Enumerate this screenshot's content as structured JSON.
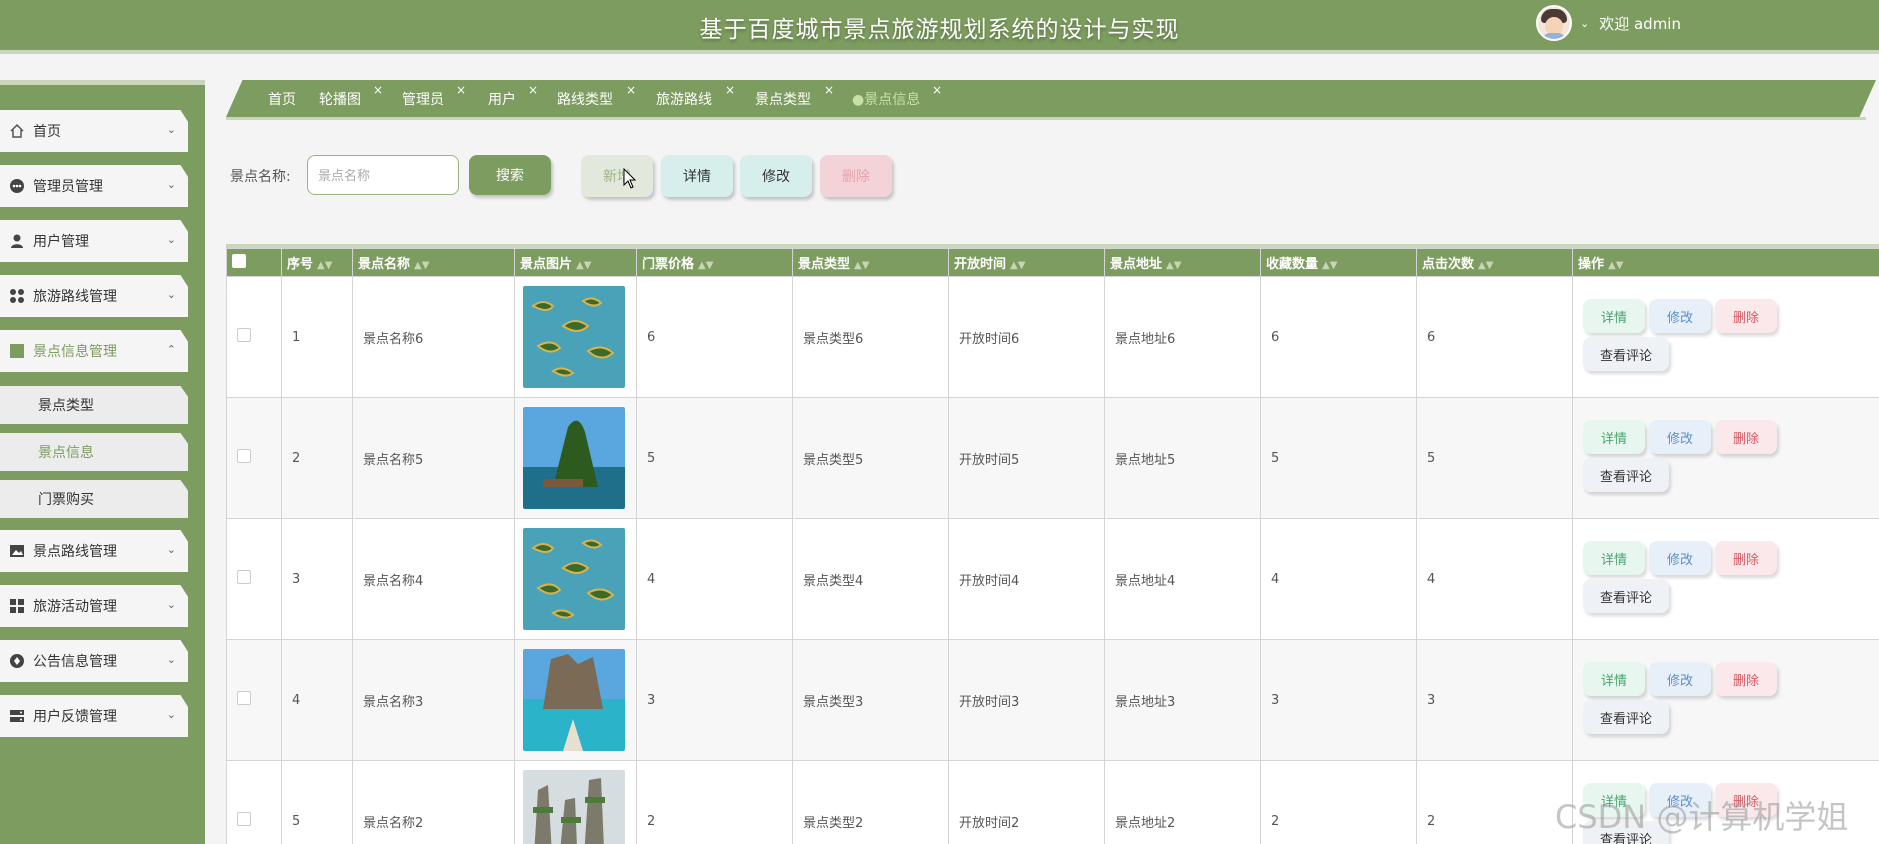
{
  "header": {
    "title": "基于百度城市景点旅游规划系统的设计与实现",
    "welcome": "欢迎 admin"
  },
  "sidebar": {
    "items": [
      {
        "label": "首页",
        "icon": "home-icon"
      },
      {
        "label": "管理员管理",
        "icon": "admin-icon"
      },
      {
        "label": "用户管理",
        "icon": "user-icon"
      },
      {
        "label": "旅游路线管理",
        "icon": "grid-icon"
      },
      {
        "label": "景点信息管理",
        "icon": "square-icon"
      },
      {
        "label": "景点路线管理",
        "icon": "image-icon"
      },
      {
        "label": "旅游活动管理",
        "icon": "tiles-icon"
      },
      {
        "label": "公告信息管理",
        "icon": "circle-icon"
      },
      {
        "label": "用户反馈管理",
        "icon": "server-icon"
      }
    ],
    "subitems": [
      {
        "label": "景点类型"
      },
      {
        "label": "景点信息"
      },
      {
        "label": "门票购买"
      }
    ]
  },
  "tabs": [
    {
      "label": "首页"
    },
    {
      "label": "轮播图"
    },
    {
      "label": "管理员"
    },
    {
      "label": "用户"
    },
    {
      "label": "路线类型"
    },
    {
      "label": "旅游路线"
    },
    {
      "label": "景点类型"
    },
    {
      "label": "●景点信息"
    }
  ],
  "tab_close": "×",
  "search": {
    "label": "景点名称:",
    "placeholder": "景点名称",
    "button": "搜索"
  },
  "toolbar": {
    "add": "新增",
    "detail": "详情",
    "edit": "修改",
    "delete": "删除"
  },
  "table": {
    "columns": [
      "序号",
      "景点名称",
      "景点图片",
      "门票价格",
      "景点类型",
      "开放时间",
      "景点地址",
      "收藏数量",
      "点击次数",
      "操作"
    ],
    "rows": [
      {
        "index": "1",
        "name": "景点名称6",
        "price": "6",
        "type": "景点类型6",
        "open": "开放时间6",
        "address": "景点地址6",
        "favorites": "6",
        "clicks": "6"
      },
      {
        "index": "2",
        "name": "景点名称5",
        "price": "5",
        "type": "景点类型5",
        "open": "开放时间5",
        "address": "景点地址5",
        "favorites": "5",
        "clicks": "5"
      },
      {
        "index": "3",
        "name": "景点名称4",
        "price": "4",
        "type": "景点类型4",
        "open": "开放时间4",
        "address": "景点地址4",
        "favorites": "4",
        "clicks": "4"
      },
      {
        "index": "4",
        "name": "景点名称3",
        "price": "3",
        "type": "景点类型3",
        "open": "开放时间3",
        "address": "景点地址3",
        "favorites": "3",
        "clicks": "3"
      },
      {
        "index": "5",
        "name": "景点名称2",
        "price": "2",
        "type": "景点类型2",
        "open": "开放时间2",
        "address": "景点地址2",
        "favorites": "2",
        "clicks": "2"
      }
    ],
    "ops": {
      "detail": "详情",
      "edit": "修改",
      "delete": "删除",
      "review": "查看评论"
    }
  },
  "watermark": "CSDN @计算机学姐",
  "colors": {
    "primary": "#7d9c5f",
    "accent_light": "#c9d6bb"
  }
}
